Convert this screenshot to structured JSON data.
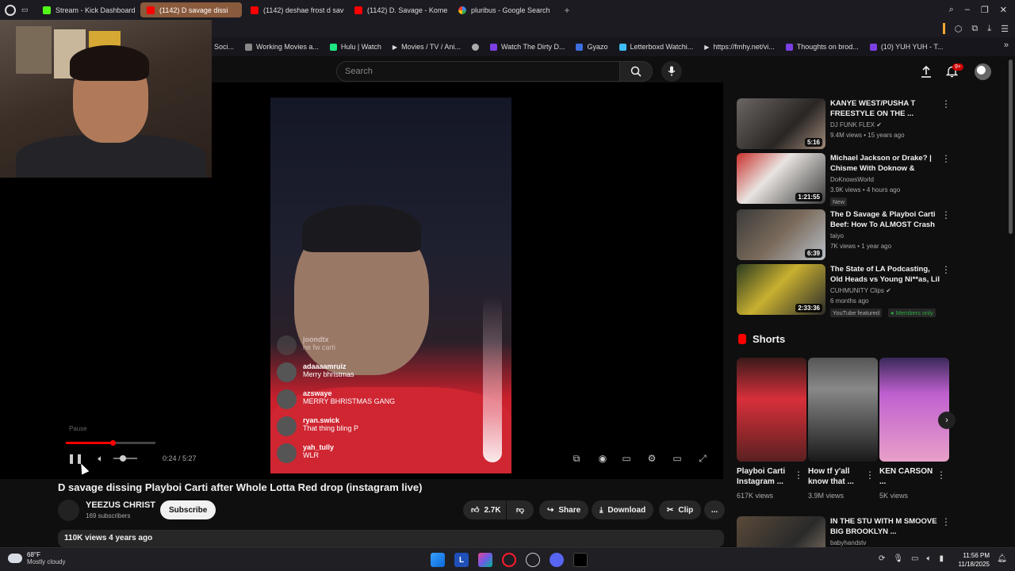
{
  "browser": {
    "tabs": [
      {
        "label": "Stream - Kick Dashboard",
        "favicon": "kick-icon",
        "active": false
      },
      {
        "label": "(1142) D savage dissi",
        "favicon": "youtube-icon",
        "active": true
      },
      {
        "label": "(1142) deshae frost d sav",
        "favicon": "youtube-icon",
        "active": false
      },
      {
        "label": "(1142) D. Savage - Kome",
        "favicon": "youtube-icon",
        "active": false
      },
      {
        "label": "pluribus - Google Search",
        "favicon": "google-icon",
        "active": false
      }
    ],
    "new_tab": "+",
    "bookmarks": [
      "Soci...",
      "Working Movies a...",
      "Hulu | Watch",
      "Movies / TV / Ani...",
      "",
      "Watch The Dirty D...",
      "Gyazo",
      "Letterboxd Watchi...",
      "https://fmhy.net/vi...",
      "Thoughts on brod...",
      "(10) YUH YUH - T..."
    ]
  },
  "youtube": {
    "search_placeholder": "Search",
    "notification_count": "9+"
  },
  "video": {
    "overlay_comments": [
      {
        "user": "joondtx",
        "text": "he fw carti",
        "faded": true
      },
      {
        "user": "adaaaamruiz",
        "text": "Merry bhristmas"
      },
      {
        "user": "azswaye",
        "text": "MERRY BHRISTMAS GANG"
      },
      {
        "user": "ryan.swick",
        "text": "That thing bling P"
      },
      {
        "user": "yah_tully",
        "text": "WLR"
      }
    ],
    "pause_tooltip": "Pause",
    "progress_fraction": 0.075,
    "time": "0:24 / 5:27",
    "title": "D savage dissing Playboi Carti after Whole Lotta Red drop (instagram live)",
    "channel": {
      "name": "YEEZUS CHRIST",
      "subscribers": "169 subscribers"
    },
    "subscribe_label": "Subscribe",
    "likes": "2.7K",
    "share_label": "Share",
    "download_label": "Download",
    "clip_label": "Clip",
    "more_label": "...",
    "description_meta": "110K views  4 years ago"
  },
  "recommendations": [
    {
      "title": "KANYE WEST/PUSHA T FREESTYLE ON THE ...",
      "channel": "DJ FUNK FLEX",
      "verified": true,
      "meta": "9.4M views • 15 years ago",
      "duration": "5:16",
      "badges": []
    },
    {
      "title": "Michael Jackson or Drake? | Chisme With Doknow & Jakart...",
      "channel": "DoKnowsWorld",
      "verified": false,
      "meta": "3.9K views • 4 hours ago",
      "duration": "1:21:55",
      "badges": [
        "New"
      ]
    },
    {
      "title": "The D Savage & Playboi Carti Beef: How To ALMOST Crash ...",
      "channel": "taiyo",
      "verified": false,
      "meta": "7K views • 1 year ago",
      "duration": "6:39",
      "badges": []
    },
    {
      "title": "The State of LA Podcasting, Old Heads vs Young Ni**as, Lil Na...",
      "channel": "CUHMUNITY Clips",
      "verified": true,
      "meta": "6 months ago",
      "duration": "2:33:36",
      "badges": [
        "YouTube featured",
        "Members only"
      ]
    }
  ],
  "shorts": {
    "heading": "Shorts",
    "items": [
      {
        "title": "Playboi Carti Instagram ...",
        "views": "617K views"
      },
      {
        "title": "How tf y'all know that ...",
        "views": "3.9M views"
      },
      {
        "title": "KEN CARSON ...",
        "views": "5K views"
      }
    ]
  },
  "next_rec": {
    "title": "IN THE STU WITH M SMOOVE BIG BROOKLYN ...",
    "channel": "babyhandstv"
  },
  "taskbar": {
    "weather_temp": "68°F",
    "weather_desc": "Mostly cloudy",
    "time": "11:56 PM",
    "date": "11/18/2025"
  },
  "colors": {
    "accent_red": "#ff0000",
    "page_bg": "#0f0f0f",
    "active_tab": "#8a5a3c"
  }
}
